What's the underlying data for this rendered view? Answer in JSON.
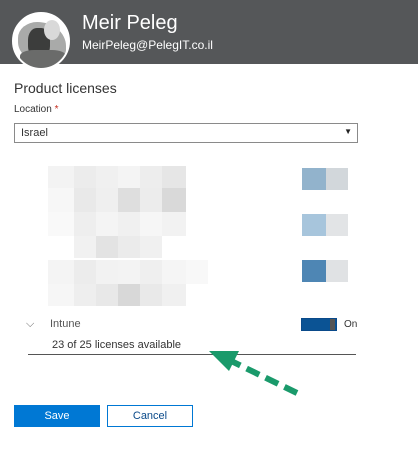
{
  "header": {
    "user_name": "Meir Peleg",
    "user_email": "MeirPeleg@PelegIT.co.il",
    "background_color": "#555759"
  },
  "panel": {
    "title": "Product licenses",
    "location": {
      "label": "Location",
      "required_mark": "*",
      "selected_value": "Israel"
    },
    "intune": {
      "label": "Intune",
      "toggle_state": "On",
      "licenses_text": "23 of 25 licenses available",
      "toggle_color": "#0b5394"
    }
  },
  "buttons": {
    "save_label": "Save",
    "cancel_label": "Cancel",
    "accent_color": "#0078d4"
  },
  "annotation": {
    "arrow_color": "#1a9a6b"
  }
}
